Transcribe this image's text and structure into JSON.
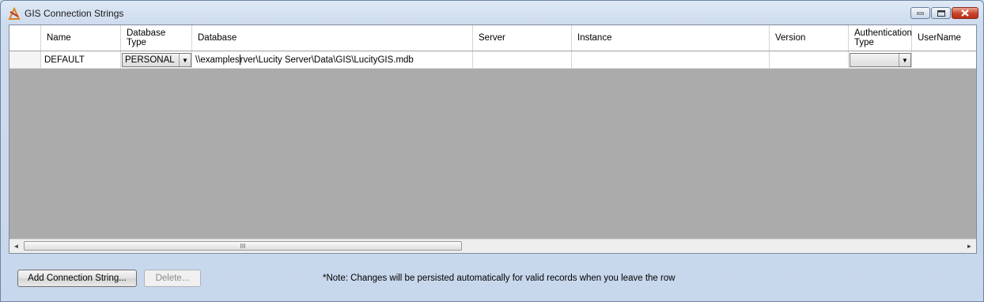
{
  "window": {
    "title": "GIS Connection Strings"
  },
  "grid": {
    "columns": [
      {
        "key": "name",
        "label": "Name"
      },
      {
        "key": "database_type",
        "label": "Database Type"
      },
      {
        "key": "database",
        "label": "Database"
      },
      {
        "key": "server",
        "label": "Server"
      },
      {
        "key": "instance",
        "label": "Instance"
      },
      {
        "key": "version",
        "label": "Version"
      },
      {
        "key": "authentication_type",
        "label": "Authentication Type"
      },
      {
        "key": "username",
        "label": "UserName"
      }
    ],
    "rows": [
      {
        "name": "DEFAULT",
        "database_type": "PERSONAL",
        "database_before_cursor": "\\\\examples",
        "database_after_cursor": "rver\\Lucity Server\\Data\\GIS\\LucityGIS.mdb",
        "server": "",
        "instance": "",
        "version": "",
        "authentication_type": "",
        "username": ""
      }
    ],
    "scroll_left_icon": "arrow-left-icon",
    "scroll_right_icon": "arrow-right-icon",
    "thumb_grip": "III"
  },
  "buttons": {
    "add_label": "Add Connection String...",
    "delete_label": "Delete..."
  },
  "note": "*Note:  Changes will be persisted automatically for valid records when you leave the row"
}
